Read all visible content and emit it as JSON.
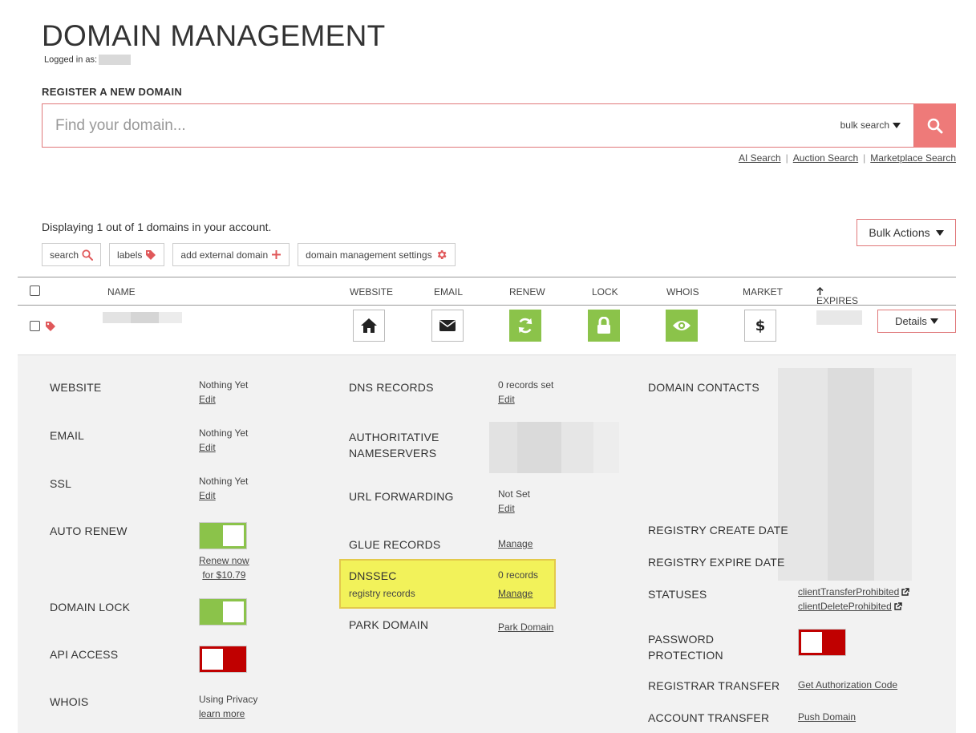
{
  "header": {
    "title": "DOMAIN MANAGEMENT",
    "logged_in_label": "Logged in as:"
  },
  "register": {
    "label": "REGISTER A NEW DOMAIN",
    "placeholder": "Find your domain...",
    "bulk_search_label": "bulk search",
    "links": [
      "AI Search",
      "Auction Search",
      "Marketplace Search"
    ]
  },
  "account": {
    "display_text": "Displaying 1 out of 1 domains in your account.",
    "bulk_actions_label": "Bulk Actions",
    "tools": {
      "search": "search",
      "labels": "labels",
      "add_external": "add external domain",
      "settings": "domain management settings"
    }
  },
  "table": {
    "columns": {
      "name": "NAME",
      "website": "WEBSITE",
      "email": "EMAIL",
      "renew": "RENEW",
      "lock": "LOCK",
      "whois": "WHOIS",
      "market": "MARKET",
      "expires": "EXPIRES"
    },
    "details_label": "Details"
  },
  "details": {
    "website": {
      "label": "WEBSITE",
      "value": "Nothing Yet",
      "action": "Edit"
    },
    "email": {
      "label": "EMAIL",
      "value": "Nothing Yet",
      "action": "Edit"
    },
    "ssl": {
      "label": "SSL",
      "value": "Nothing Yet",
      "action": "Edit"
    },
    "auto_renew": {
      "label": "AUTO RENEW",
      "state": "on",
      "renew_line1": "Renew now",
      "renew_line2": "for $10.79"
    },
    "domain_lock": {
      "label": "DOMAIN LOCK",
      "state": "on"
    },
    "api_access": {
      "label": "API ACCESS",
      "state": "off"
    },
    "whois": {
      "label": "WHOIS",
      "value": "Using Privacy",
      "action": "learn more"
    },
    "dns_records": {
      "label": "DNS RECORDS",
      "value": "0 records set",
      "action": "Edit"
    },
    "auth_ns": {
      "label_line1": "AUTHORITATIVE",
      "label_line2": "NAMESERVERS"
    },
    "url_forwarding": {
      "label": "URL FORWARDING",
      "value": "Not Set",
      "action": "Edit"
    },
    "glue_records": {
      "label": "GLUE RECORDS",
      "action": "Manage"
    },
    "dnssec": {
      "label": "DNSSEC",
      "sublabel": "registry records",
      "value": "0 records",
      "action": "Manage"
    },
    "park_domain": {
      "label": "PARK DOMAIN",
      "action": "Park Domain"
    },
    "domain_contacts": {
      "label": "DOMAIN CONTACTS"
    },
    "registry_create": {
      "label": "REGISTRY CREATE DATE"
    },
    "registry_expire": {
      "label": "REGISTRY EXPIRE DATE"
    },
    "statuses": {
      "label": "STATUSES",
      "items": [
        "clientTransferProhibited",
        "clientDeleteProhibited"
      ]
    },
    "password_protection": {
      "label_line1": "PASSWORD",
      "label_line2": "PROTECTION",
      "state": "off"
    },
    "registrar_transfer": {
      "label": "REGISTRAR TRANSFER",
      "action": "Get Authorization Code"
    },
    "account_transfer": {
      "label": "ACCOUNT TRANSFER",
      "action": "Push Domain"
    }
  },
  "colors": {
    "accent": "#ee7a79",
    "toggle_on": "#8bc34a",
    "toggle_off": "#c00000",
    "highlight": "#f2f25a"
  }
}
